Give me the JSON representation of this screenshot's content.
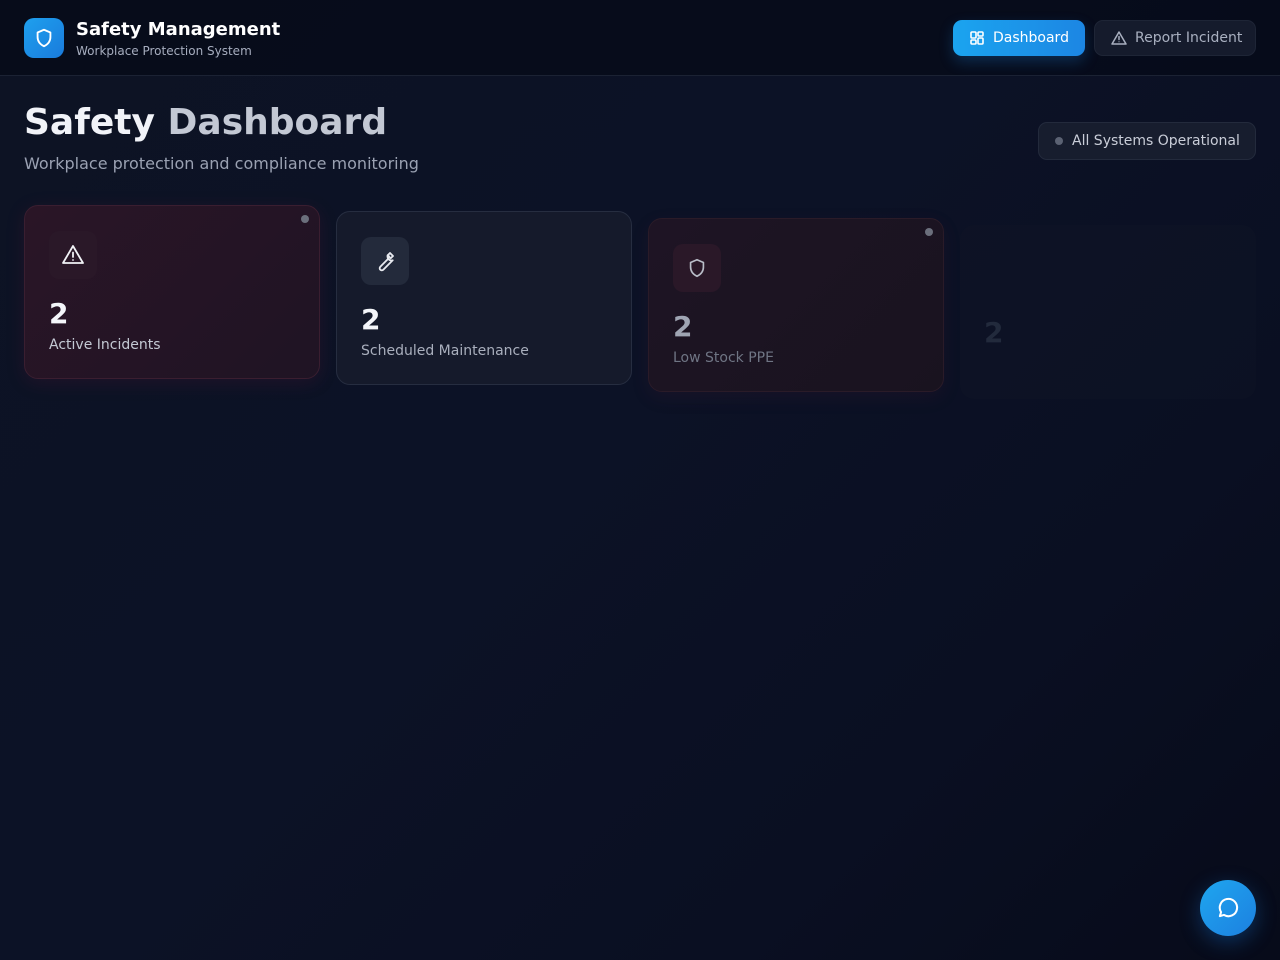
{
  "app": {
    "title": "Safety Management",
    "subtitle": "Workplace Protection System"
  },
  "nav": {
    "dashboard": {
      "label": "Dashboard",
      "icon": "grid-icon",
      "active": true
    },
    "report": {
      "label": "Report Incident",
      "icon": "warning-triangle-icon",
      "active": false
    }
  },
  "page": {
    "title_part1": "Safety",
    "title_part2": "Dashboard",
    "subtitle": "Workplace protection and compliance monitoring"
  },
  "status": {
    "label": "All Systems Operational"
  },
  "stats": [
    {
      "value": "2",
      "label": "Active Incidents",
      "icon": "warning-triangle-icon",
      "accent": "#3a1e30"
    },
    {
      "value": "2",
      "label": "Scheduled Maintenance",
      "icon": "wrench-icon",
      "accent": "#262d40"
    },
    {
      "value": "2",
      "label": "Low Stock PPE",
      "icon": "shield-icon",
      "accent": "#2a1b28"
    },
    {
      "value": "2",
      "label": "",
      "icon": "",
      "accent": "#151a2b"
    }
  ],
  "chat": {
    "icon": "chat-bubble-icon"
  },
  "colors": {
    "brand": "#1ea0ee",
    "background": "#0c1226"
  }
}
